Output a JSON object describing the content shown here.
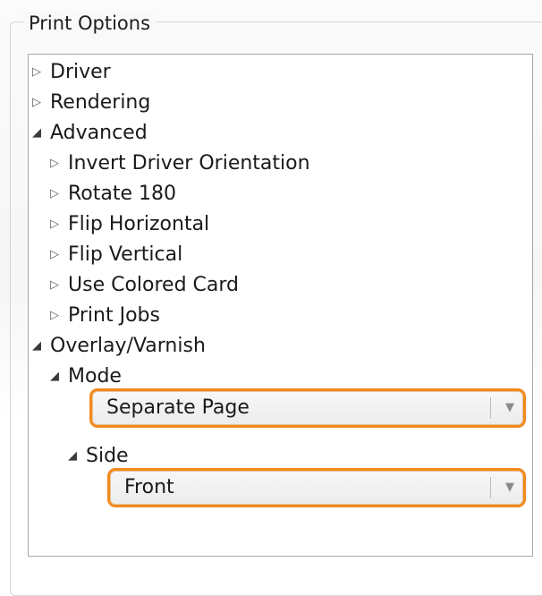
{
  "group": {
    "title": "Print Options"
  },
  "tree": {
    "driver": "Driver",
    "rendering": "Rendering",
    "advanced": "Advanced",
    "invert_driver_orientation": "Invert Driver Orientation",
    "rotate_180": "Rotate 180",
    "flip_horizontal": "Flip Horizontal",
    "flip_vertical": "Flip Vertical",
    "use_colored_card": "Use Colored Card",
    "print_jobs": "Print Jobs",
    "overlay_varnish": "Overlay/Varnish",
    "mode": "Mode",
    "side": "Side"
  },
  "controls": {
    "mode_value": "Separate Page",
    "side_value": "Front"
  },
  "icons": {
    "collapsed": "▷",
    "expanded": "◢",
    "dropdown": "▼"
  },
  "colors": {
    "highlight": "#f28a1e"
  }
}
